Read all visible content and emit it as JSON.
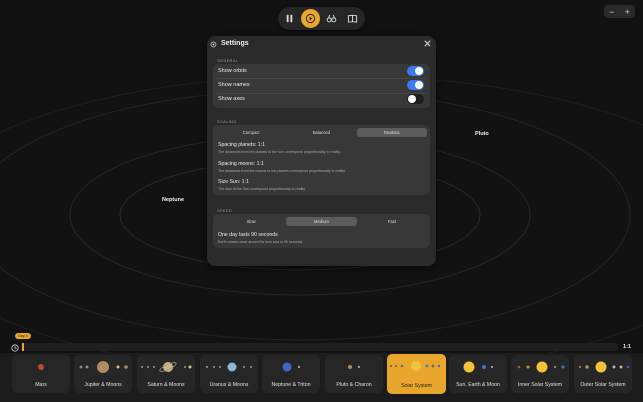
{
  "scene": {
    "labels": {
      "neptune": "Neptune",
      "pluto": "Pluto"
    }
  },
  "toolbar": {
    "buttons": [
      "pause",
      "play",
      "binoculars",
      "book"
    ],
    "accent": "#e8a72c"
  },
  "zoom": {
    "minus": "−",
    "plus": "+"
  },
  "settings": {
    "title": "Settings",
    "general": {
      "label": "GENERAL",
      "show_orbits": "Show orbits",
      "show_names": "Show names",
      "show_axes": "Show axes"
    },
    "toggles": {
      "show_orbits": true,
      "show_names": true,
      "show_axes": false
    },
    "scaling": {
      "label": "SCALING",
      "options": [
        "Compact",
        "Balanced",
        "Realistic"
      ],
      "selected": "Realistic",
      "planets_title": "Spacing planets: 1:1",
      "planets_desc": "The distances from the planets to the sun correspond proportionally to reality.",
      "moons_title": "Spacing moons: 1:1",
      "moons_desc": "The distances from the moons to the planets correspond proportionally to reality.",
      "sun_title": "Size Sun: 1:1",
      "sun_desc": "The size of the Sun correspond proportionally to reality."
    },
    "speed": {
      "label": "SPEED",
      "options": [
        "Slow",
        "Medium",
        "Fast"
      ],
      "selected": "Medium",
      "title": "One day lasts 90 seconds",
      "desc": "Earth rotates once around its own axis in 90 seconds."
    }
  },
  "timeline": {
    "day": "Day 4",
    "ratio": "1:1",
    "progress": 0.0
  },
  "cards": [
    {
      "label": "Mars"
    },
    {
      "label": "Jupiter & Moons"
    },
    {
      "label": "Saturn & Moons"
    },
    {
      "label": "Uranus & Moons"
    },
    {
      "label": "Neptune & Triton"
    },
    {
      "label": "Pluto & Charon"
    },
    {
      "label": "Solar System",
      "active": true
    },
    {
      "label": "Sun, Earth & Moon"
    },
    {
      "label": "Inner Solar System"
    },
    {
      "label": "Outer Solar System"
    }
  ]
}
